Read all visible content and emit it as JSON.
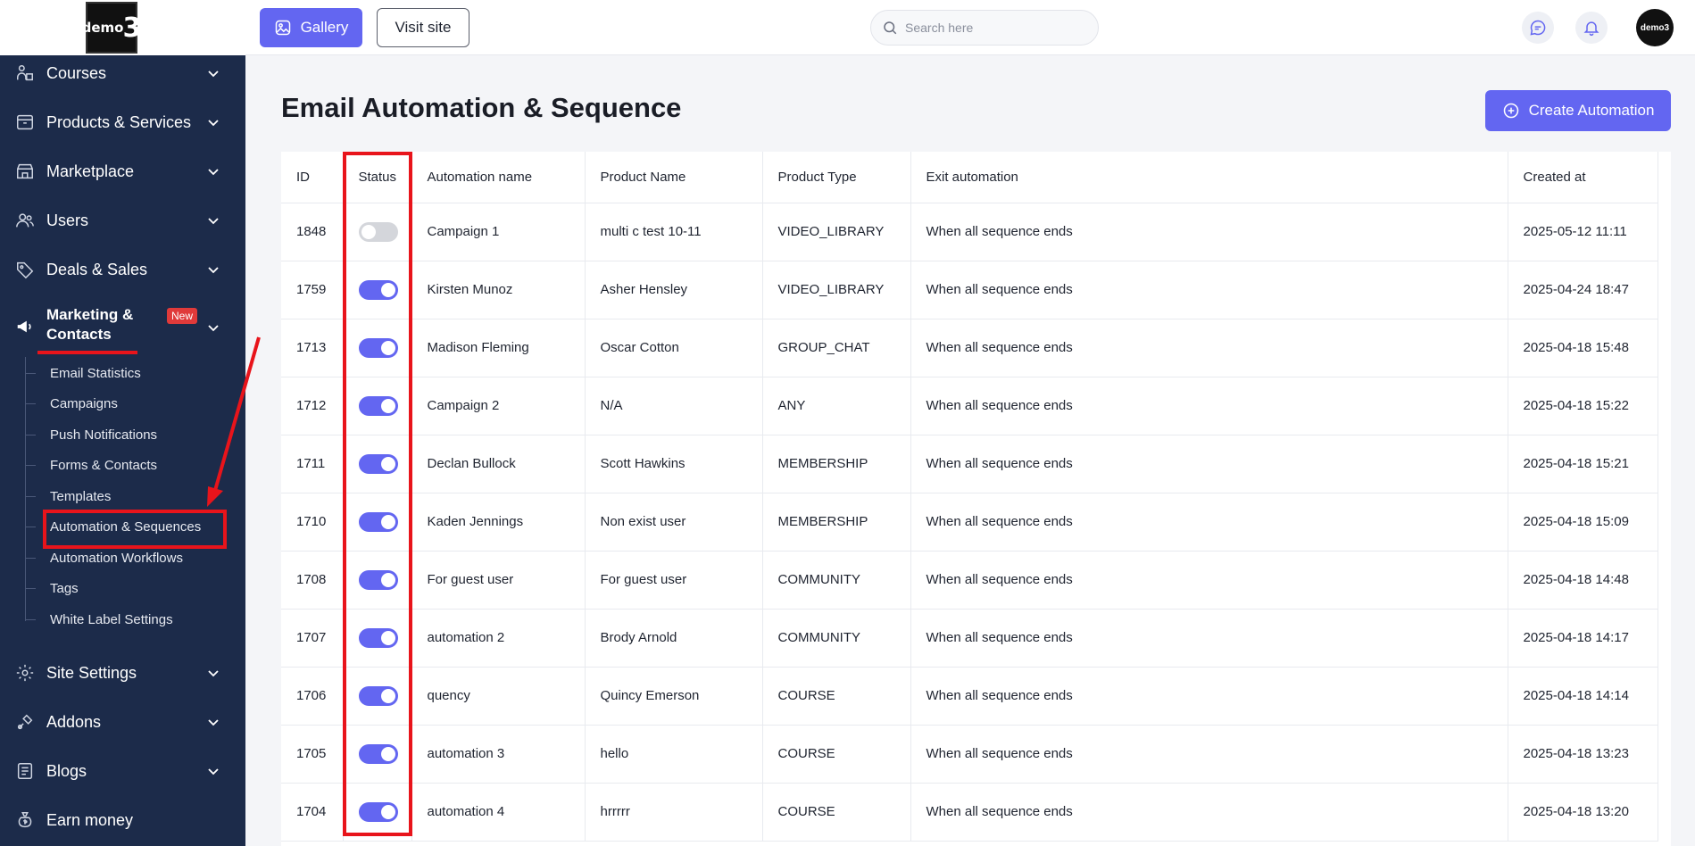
{
  "logo": {
    "text_small": "demo",
    "text_big": "3"
  },
  "topbar": {
    "gallery_label": "Gallery",
    "visit_label": "Visit site",
    "search_placeholder": "Search here",
    "avatar_text": "demo3"
  },
  "sidebar": {
    "items": [
      {
        "label": "Courses",
        "icon": "courses-icon"
      },
      {
        "label": "Products & Services",
        "icon": "box-icon"
      },
      {
        "label": "Marketplace",
        "icon": "store-icon"
      },
      {
        "label": "Users",
        "icon": "users-icon"
      },
      {
        "label": "Deals & Sales",
        "icon": "tag-icon"
      },
      {
        "label": "Marketing & Contacts",
        "icon": "megaphone-icon",
        "line1": "Marketing &",
        "line2": "Contacts",
        "badge": "New"
      },
      {
        "label": "Site Settings",
        "icon": "gear-icon"
      },
      {
        "label": "Addons",
        "icon": "addons-icon"
      },
      {
        "label": "Blogs",
        "icon": "blog-icon"
      },
      {
        "label": "Earn money",
        "icon": "money-bag-icon"
      }
    ],
    "submenu": [
      "Email Statistics",
      "Campaigns",
      "Push Notifications",
      "Forms & Contacts",
      "Templates",
      "Automation & Sequences",
      "Automation Workflows",
      "Tags",
      "White Label Settings"
    ]
  },
  "main": {
    "title": "Email Automation & Sequence",
    "create_label": "Create Automation",
    "columns": [
      "ID",
      "Status",
      "Automation name",
      "Product Name",
      "Product Type",
      "Exit automation",
      "Created at"
    ],
    "rows": [
      {
        "id": "1848",
        "status": false,
        "name": "Campaign 1",
        "product": "multi c test 10-11",
        "type": "VIDEO_LIBRARY",
        "exit": "When all sequence ends",
        "created": "2025-05-12 11:11"
      },
      {
        "id": "1759",
        "status": true,
        "name": "Kirsten Munoz",
        "product": "Asher Hensley",
        "type": "VIDEO_LIBRARY",
        "exit": "When all sequence ends",
        "created": "2025-04-24 18:47"
      },
      {
        "id": "1713",
        "status": true,
        "name": "Madison Fleming",
        "product": "Oscar Cotton",
        "type": "GROUP_CHAT",
        "exit": "When all sequence ends",
        "created": "2025-04-18 15:48"
      },
      {
        "id": "1712",
        "status": true,
        "name": "Campaign 2",
        "product": "N/A",
        "type": "ANY",
        "exit": "When all sequence ends",
        "created": "2025-04-18 15:22"
      },
      {
        "id": "1711",
        "status": true,
        "name": "Declan Bullock",
        "product": "Scott Hawkins",
        "type": "MEMBERSHIP",
        "exit": "When all sequence ends",
        "created": "2025-04-18 15:21"
      },
      {
        "id": "1710",
        "status": true,
        "name": "Kaden Jennings",
        "product": "Non exist user",
        "type": "MEMBERSHIP",
        "exit": "When all sequence ends",
        "created": "2025-04-18 15:09"
      },
      {
        "id": "1708",
        "status": true,
        "name": "For guest user",
        "product": "For guest user",
        "type": "COMMUNITY",
        "exit": "When all sequence ends",
        "created": "2025-04-18 14:48"
      },
      {
        "id": "1707",
        "status": true,
        "name": "automation 2",
        "product": "Brody Arnold",
        "type": "COMMUNITY",
        "exit": "When all sequence ends",
        "created": "2025-04-18 14:17"
      },
      {
        "id": "1706",
        "status": true,
        "name": "quency",
        "product": "Quincy Emerson",
        "type": "COURSE",
        "exit": "When all sequence ends",
        "created": "2025-04-18 14:14"
      },
      {
        "id": "1705",
        "status": true,
        "name": "automation 3",
        "product": "hello",
        "type": "COURSE",
        "exit": "When all sequence ends",
        "created": "2025-04-18 13:23"
      },
      {
        "id": "1704",
        "status": true,
        "name": "automation 4",
        "product": "hrrrrr",
        "type": "COURSE",
        "exit": "When all sequence ends",
        "created": "2025-04-18 13:20"
      }
    ]
  },
  "colors": {
    "sidebar_bg": "#1c2b4a",
    "accent": "#6366f1",
    "highlight": "#e8141b",
    "badge": "#e03a3a"
  }
}
